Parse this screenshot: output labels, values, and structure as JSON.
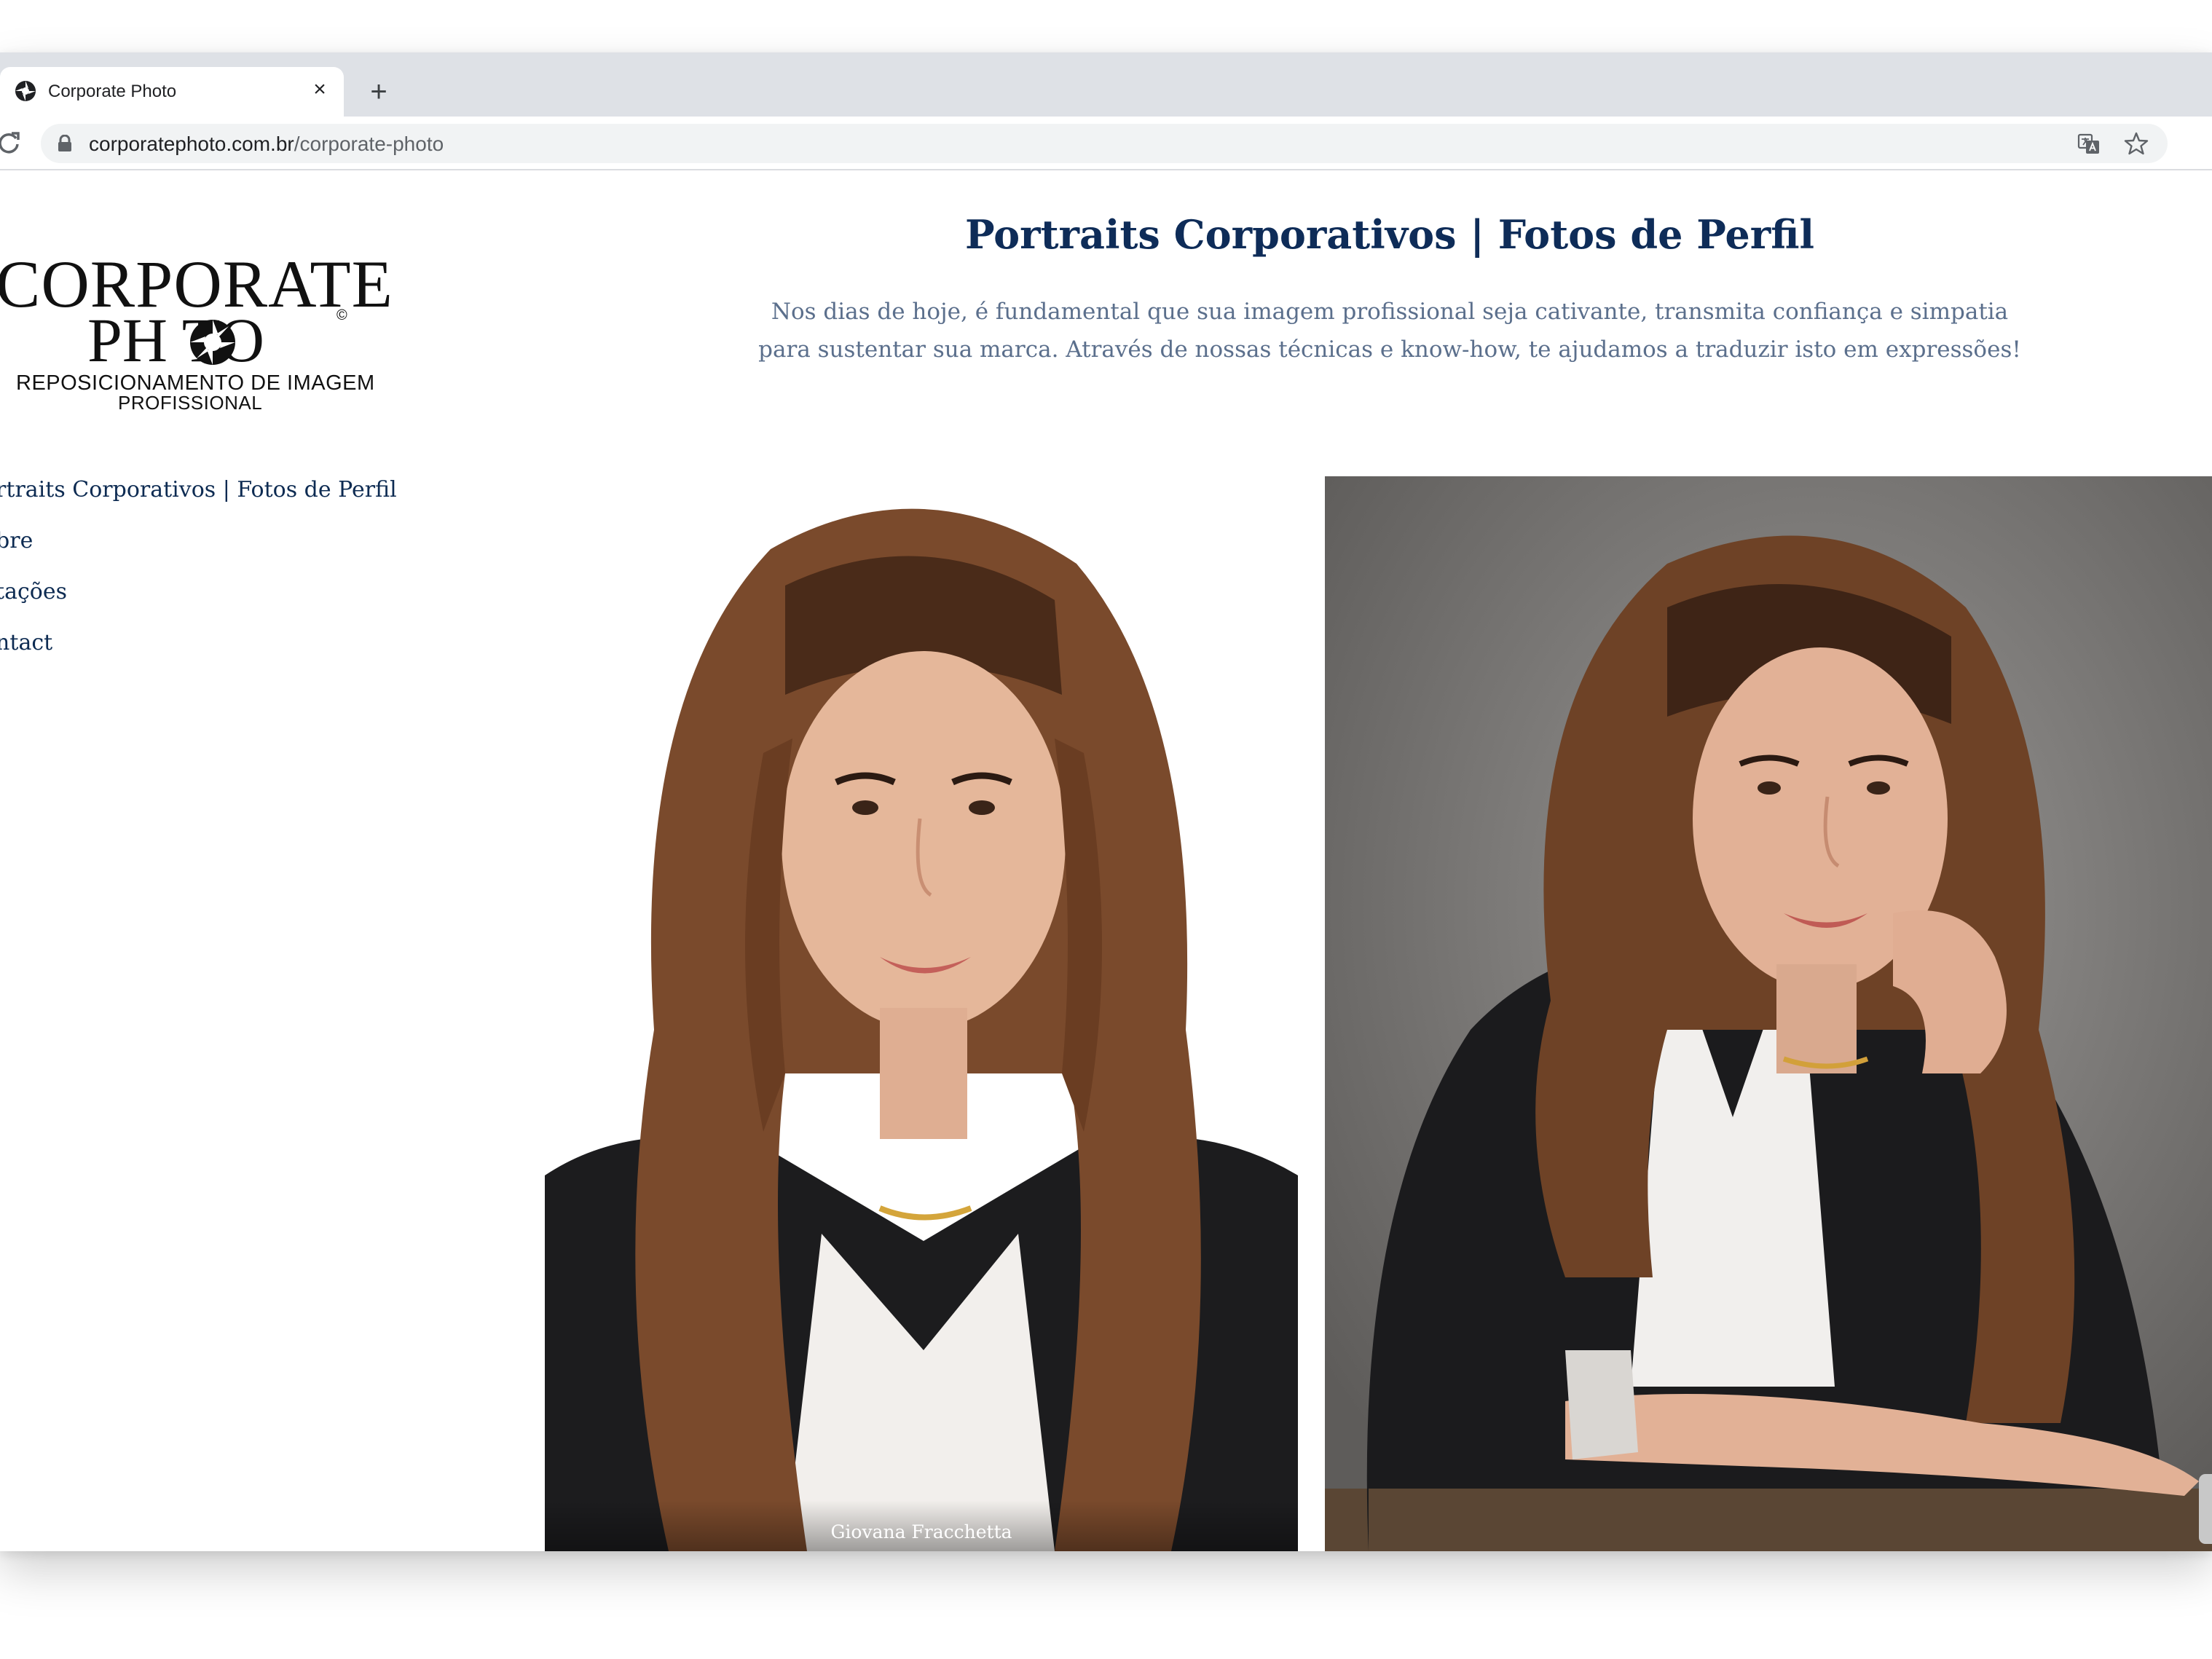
{
  "browser": {
    "tab_title": "Corporate Photo",
    "tab_close": "×",
    "new_tab": "+",
    "url_host": "corporatephoto.com.br",
    "url_path": "/corporate-photo"
  },
  "logo": {
    "line1": "CORPORATE",
    "line2": "PH  TO",
    "copyright": "©",
    "tagline1": "REPOSICIONAMENTO DE IMAGEM",
    "tagline2": "PROFISSIONAL"
  },
  "nav": {
    "items": [
      {
        "label": "ortraits Corporativos | Fotos de Perfil"
      },
      {
        "label": "obre"
      },
      {
        "label": "otações"
      },
      {
        "label": "ontact"
      }
    ]
  },
  "main": {
    "heading": "Portraits Corporativos | Fotos de Perfil",
    "intro_line1": "Nos dias de hoje, é fundamental que sua imagem profissional seja cativante, transmita confiança e simpatia",
    "intro_line2": "para sustentar sua marca. Através de nossas técnicas e know-how, te ajudamos a traduzir isto em expressões!",
    "photo1_caption": "Giovana Fracchetta"
  },
  "colors": {
    "heading": "#0e2c58",
    "nav": "#0d2b52",
    "intro": "#5b6f8c",
    "tabstrip": "#dee1e6"
  }
}
